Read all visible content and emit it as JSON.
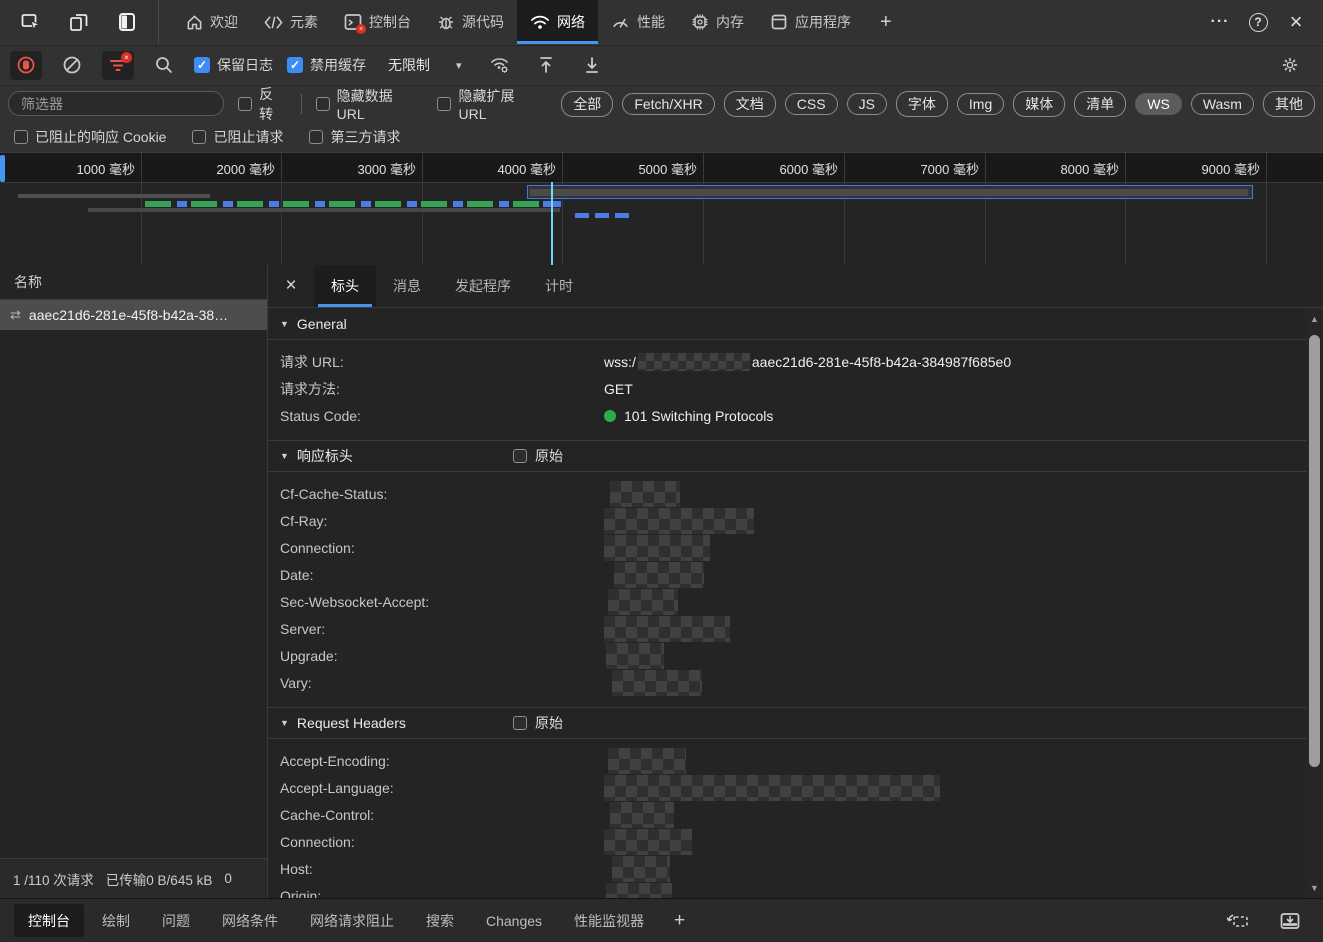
{
  "colors": {
    "accent_blue": "#4596f0",
    "checkbox_blue": "#3d8df5",
    "record_red": "#e8554d",
    "status_green": "#2dad4e",
    "waterfall_green": "#35a457",
    "waterfall_blue": "#4a7de8",
    "cursor_cyan": "#70d6fa"
  },
  "icons": {
    "more": "···",
    "help": "?",
    "close": "×",
    "dropdown_arrow": "▾",
    "check": "✓",
    "websocket": "⇄",
    "disclosure": "▼",
    "scroll_up": "▲",
    "scroll_down": "▼",
    "add_tab": "+"
  },
  "top_bar": {
    "tabs": [
      {
        "label": "欢迎"
      },
      {
        "label": "元素"
      },
      {
        "label": "控制台"
      },
      {
        "label": "源代码"
      },
      {
        "label": "网络"
      },
      {
        "label": "性能"
      },
      {
        "label": "内存"
      },
      {
        "label": "应用程序"
      }
    ],
    "active_tab": "网络"
  },
  "network_toolbar": {
    "preserve_log": "保留日志",
    "disable_cache": "禁用缓存",
    "throttle_value": "无限制"
  },
  "filter_bar": {
    "placeholder": "筛选器",
    "invert": "反转",
    "hide_data_url": "隐藏数据 URL",
    "hide_ext_url": "隐藏扩展 URL",
    "pills": [
      "全部",
      "Fetch/XHR",
      "文档",
      "CSS",
      "JS",
      "字体",
      "Img",
      "媒体",
      "清单",
      "WS",
      "Wasm",
      "其他"
    ],
    "active_pill": "WS"
  },
  "blocked_row": {
    "items": [
      "已阻止的响应 Cookie",
      "已阻止请求",
      "第三方请求"
    ]
  },
  "timeline": {
    "labels": [
      "1000 毫秒",
      "2000 毫秒",
      "3000 毫秒",
      "4000 毫秒",
      "5000 毫秒",
      "6000 毫秒",
      "7000 毫秒",
      "8000 毫秒",
      "9000 毫秒"
    ]
  },
  "requests_panel": {
    "column_header": "名称",
    "selected_request": "aaec21d6-281e-45f8-b42a-38…",
    "status_requests": "1 /110 次请求",
    "status_transferred": "已传输0 B/645 kB",
    "status_resources": "0"
  },
  "details_panel": {
    "tabs": [
      "标头",
      "消息",
      "发起程序",
      "计时"
    ],
    "active_tab": "标头",
    "general": {
      "title": "General",
      "url_label": "请求 URL:",
      "url_prefix": "wss:/",
      "url_suffix": "aaec21d6-281e-45f8-b42a-384987f685e0",
      "method_label": "请求方法:",
      "method_value": "GET",
      "status_label": "Status Code:",
      "status_value": "101 Switching Protocols"
    },
    "response_headers": {
      "title": "响应标头",
      "raw_label": "原始",
      "headers": [
        "Cf-Cache-Status:",
        "Cf-Ray:",
        "Connection:",
        "Date:",
        "Sec-Websocket-Accept:",
        "Server:",
        "Upgrade:",
        "Vary:"
      ]
    },
    "request_headers": {
      "title": "Request Headers",
      "raw_label": "原始",
      "headers": [
        "Accept-Encoding:",
        "Accept-Language:",
        "Cache-Control:",
        "Connection:",
        "Host:",
        "Origin:"
      ]
    }
  },
  "bottom_drawer": {
    "tabs": [
      "控制台",
      "绘制",
      "问题",
      "网络条件",
      "网络请求阻止",
      "搜索",
      "Changes",
      "性能监视器"
    ],
    "active_tab": "控制台"
  }
}
